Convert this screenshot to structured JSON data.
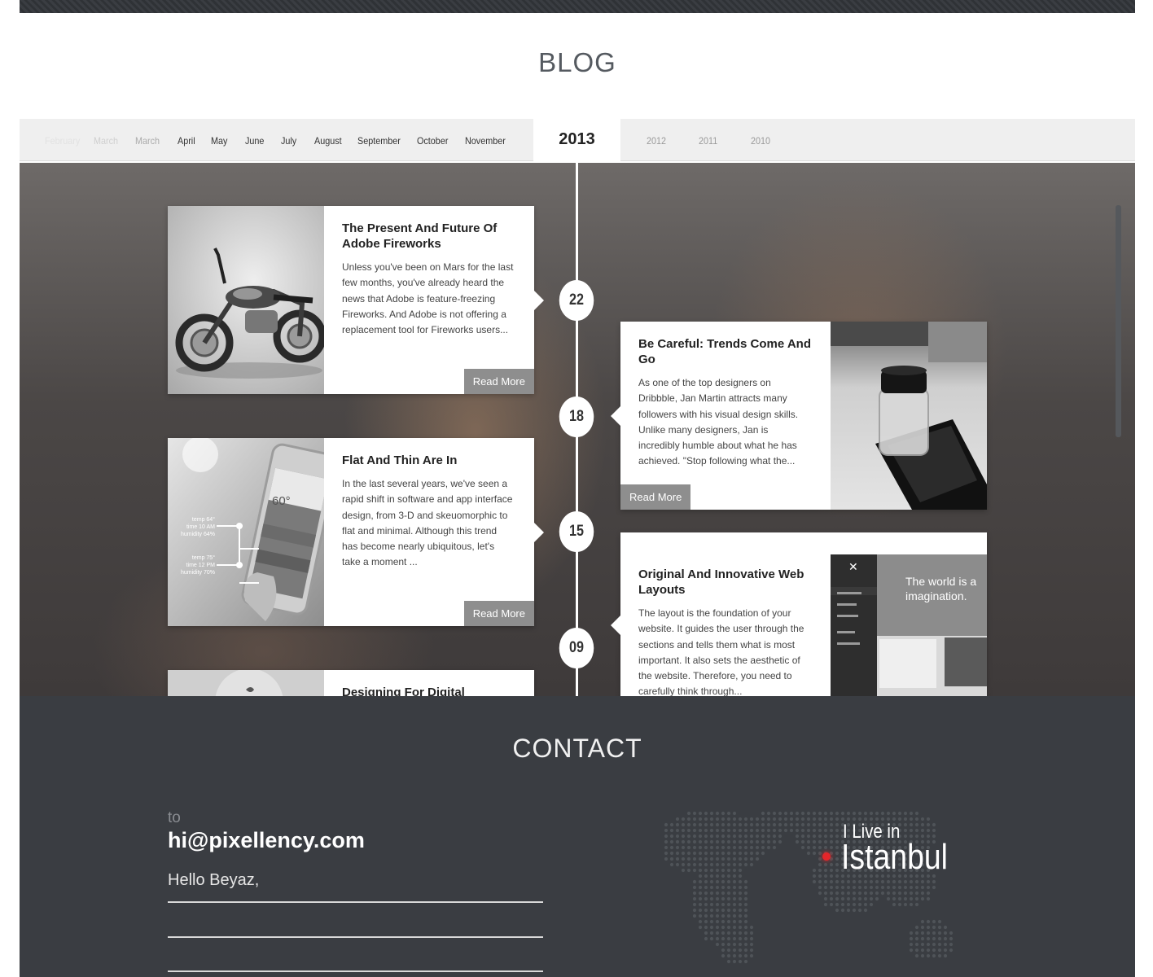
{
  "blog": {
    "title": "BLOG",
    "months": [
      "February",
      "March",
      "March",
      "April",
      "May",
      "June",
      "July",
      "August",
      "September",
      "October",
      "November"
    ],
    "active_year": "2013",
    "years": [
      "2012",
      "2011",
      "2010"
    ]
  },
  "posts": [
    {
      "day": "22",
      "title": "The Present And Future Of Adobe Fireworks",
      "excerpt": "Unless you've been on Mars for the last few months, you've already heard the news that Adobe is feature-freezing Fireworks. And Adobe is not offering a replacement tool for Fireworks users...",
      "read_more": "Read More",
      "image": "motorcycle-photo"
    },
    {
      "day": "18",
      "title": "Be Careful: Trends Come And Go",
      "excerpt": "As one of the top designers on Dribbble, Jan Martin attracts many followers with his visual design skills. Unlike many designers, Jan is incredibly humble about what he has achieved. \"Stop following what the...",
      "read_more": "Read More",
      "image": "jar-on-phone-photo"
    },
    {
      "day": "15",
      "title": "Flat And Thin Are In",
      "excerpt": "In the last several years, we've seen a rapid shift in software and app interface design, from 3-D and skeuomorphic to flat and minimal. Although this trend has become nearly ubiquitous, let's take a moment ...",
      "read_more": "Read More",
      "image": "weather-app-phone-photo",
      "weather": {
        "temp": "60°",
        "labels": [
          "temp 64°",
          "time 10 AM",
          "humidity 64%",
          "temp 75°",
          "time 12 PM",
          "humidity 70%"
        ]
      }
    },
    {
      "day": "09",
      "title": "Original And Innovative Web Layouts",
      "excerpt": "The layout is the foundation of your website. It guides the user through the sections and tells them what is most important. It also sets the aesthetic of the website. Therefore, you need to carefully think through...",
      "image": "website-layout-screenshot",
      "screenshot_text": "The world is a imagination."
    },
    {
      "title": "Designing For Digital",
      "image": "icon-photo"
    }
  ],
  "contact": {
    "title": "CONTACT",
    "to_label": "to",
    "email": "hi@pixellency.com",
    "message": "Hello Beyaz,",
    "live_small": "I Live in",
    "city": "Istanbul"
  },
  "colors": {
    "accent_red": "#e4262a",
    "contact_bg": "#3a3d42",
    "readmore_bg": "#8e8e8e"
  }
}
